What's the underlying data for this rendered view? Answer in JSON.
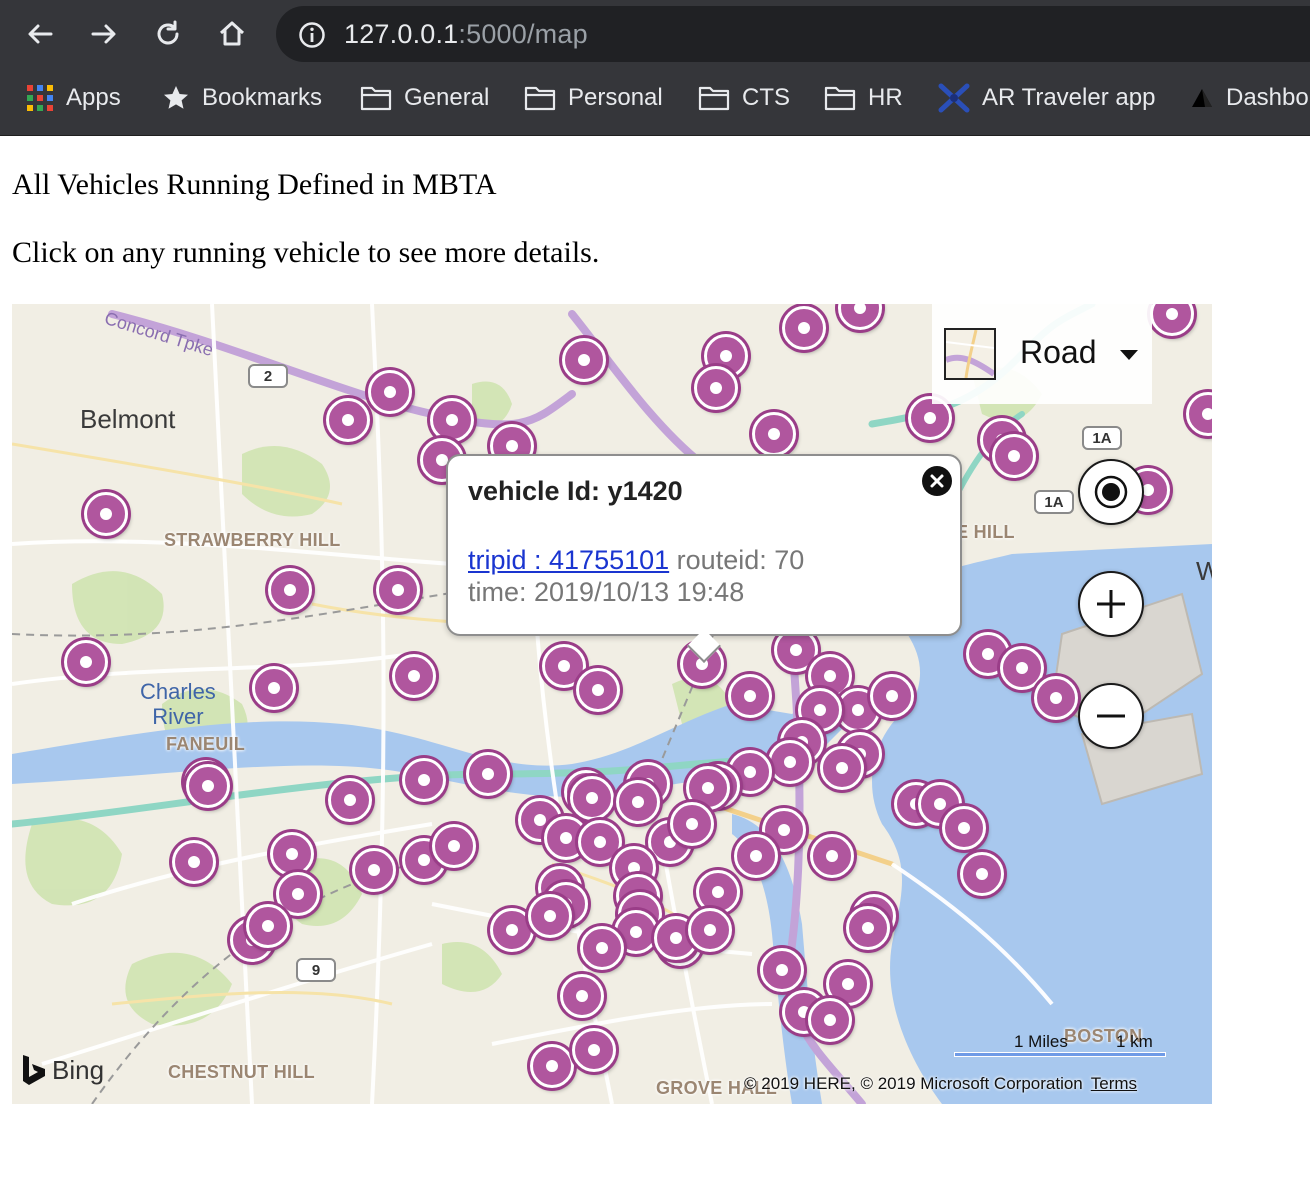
{
  "browser": {
    "url_host": "127.0.0.1",
    "url_rest": ":5000/map",
    "bookmarks": [
      {
        "label": "Apps",
        "icon": "apps-grid-icon"
      },
      {
        "label": "Bookmarks",
        "icon": "star-icon"
      },
      {
        "label": "General",
        "icon": "folder-icon"
      },
      {
        "label": "Personal",
        "icon": "folder-icon"
      },
      {
        "label": "CTS",
        "icon": "folder-icon"
      },
      {
        "label": "HR",
        "icon": "folder-icon"
      },
      {
        "label": "AR Traveler app",
        "icon": "ar-traveler-icon"
      },
      {
        "label": "Dashbo",
        "icon": "triangle-icon"
      }
    ]
  },
  "page": {
    "title": "All Vehicles Running Defined in MBTA",
    "instructions": "Click on any running vehicle to see more details."
  },
  "map": {
    "map_style": "Road",
    "labels": {
      "belmont": "Belmont",
      "strawberry_hill": "STRAWBERRY HILL",
      "charles_river_1": "Charles",
      "charles_river_2": "River",
      "faneuil": "FANEUIL",
      "chestnut_hill": "CHESTNUT HILL",
      "grove_hall": "GROVE HALL",
      "hill_partial": "E HILL",
      "boston_harbor": "BOSTON",
      "concord_tpke": "Concord Tpke",
      "w_partial": "W"
    },
    "shields": [
      "2",
      "9",
      "1A",
      "1A"
    ],
    "infobox": {
      "title": "vehicle Id: y1420",
      "trip_link": "tripid : 41755101",
      "route": "routeid: 70",
      "time": "time: 2019/10/13 19:48"
    },
    "bing_logo": "Bing",
    "scale_miles": "1 Miles",
    "scale_km": "1 km",
    "copyright": "© 2019 HERE, © 2019 Microsoft Corporation",
    "terms": "Terms",
    "accent_color": "#a0418f"
  }
}
